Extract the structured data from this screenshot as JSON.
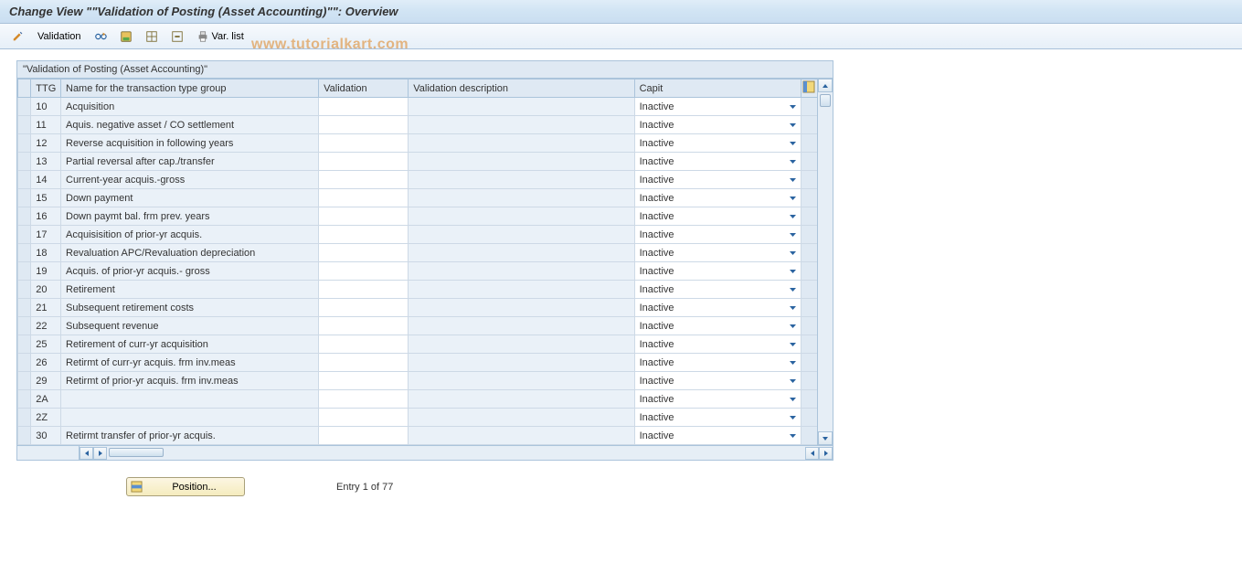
{
  "title": "Change View \"\"Validation of Posting (Asset Accounting)\"\": Overview",
  "toolbar": {
    "validation_label": "Validation",
    "varlist_label": "Var. list"
  },
  "watermark": "www.tutorialkart.com",
  "section_header": "\"Validation of Posting (Asset Accounting)\"",
  "columns": {
    "ttg": "TTG",
    "name": "Name for the transaction type group",
    "validation": "Validation",
    "desc": "Validation description",
    "capit": "Capit"
  },
  "rows": [
    {
      "ttg": "10",
      "name": "Acquisition",
      "validation": "",
      "desc": "",
      "capit": "Inactive"
    },
    {
      "ttg": "11",
      "name": "Aquis. negative asset / CO settlement",
      "validation": "",
      "desc": "",
      "capit": "Inactive"
    },
    {
      "ttg": "12",
      "name": "Reverse acquisition in following years",
      "validation": "",
      "desc": "",
      "capit": "Inactive"
    },
    {
      "ttg": "13",
      "name": "Partial reversal after cap./transfer",
      "validation": "",
      "desc": "",
      "capit": "Inactive"
    },
    {
      "ttg": "14",
      "name": "Current-year acquis.-gross",
      "validation": "",
      "desc": "",
      "capit": "Inactive"
    },
    {
      "ttg": "15",
      "name": "Down payment",
      "validation": "",
      "desc": "",
      "capit": "Inactive"
    },
    {
      "ttg": "16",
      "name": "Down paymt bal. frm prev. years",
      "validation": "",
      "desc": "",
      "capit": "Inactive"
    },
    {
      "ttg": "17",
      "name": "Acquisisition of prior-yr acquis.",
      "validation": "",
      "desc": "",
      "capit": "Inactive"
    },
    {
      "ttg": "18",
      "name": "Revaluation APC/Revaluation depreciation",
      "validation": "",
      "desc": "",
      "capit": "Inactive"
    },
    {
      "ttg": "19",
      "name": "Acquis. of prior-yr acquis.- gross",
      "validation": "",
      "desc": "",
      "capit": "Inactive"
    },
    {
      "ttg": "20",
      "name": "Retirement",
      "validation": "",
      "desc": "",
      "capit": "Inactive"
    },
    {
      "ttg": "21",
      "name": "Subsequent retirement costs",
      "validation": "",
      "desc": "",
      "capit": "Inactive"
    },
    {
      "ttg": "22",
      "name": "Subsequent revenue",
      "validation": "",
      "desc": "",
      "capit": "Inactive"
    },
    {
      "ttg": "25",
      "name": "Retirement of curr-yr acquisition",
      "validation": "",
      "desc": "",
      "capit": "Inactive"
    },
    {
      "ttg": "26",
      "name": "Retirmt of curr-yr acquis. frm inv.meas",
      "validation": "",
      "desc": "",
      "capit": "Inactive"
    },
    {
      "ttg": "29",
      "name": "Retirmt of prior-yr acquis. frm inv.meas",
      "validation": "",
      "desc": "",
      "capit": "Inactive"
    },
    {
      "ttg": "2A",
      "name": "",
      "validation": "",
      "desc": "",
      "capit": "Inactive"
    },
    {
      "ttg": "2Z",
      "name": "",
      "validation": "",
      "desc": "",
      "capit": "Inactive"
    },
    {
      "ttg": "30",
      "name": "Retirmt transfer of prior-yr acquis.",
      "validation": "",
      "desc": "",
      "capit": "Inactive"
    }
  ],
  "footer": {
    "position_label": "Position...",
    "entry_text": "Entry 1 of 77"
  }
}
